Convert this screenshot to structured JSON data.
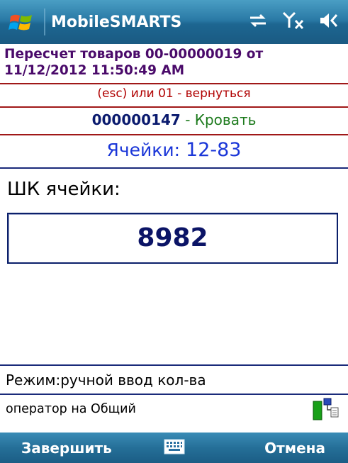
{
  "titlebar": {
    "app_name": "MobileSMARTS",
    "icons": [
      "windows-start-icon",
      "sync-icon",
      "no-signal-icon",
      "volume-icon"
    ]
  },
  "document": {
    "title": "Пересчет товаров 00-00000019 от 11/12/2012 11:50:49 AM"
  },
  "back_hint": "(esc) или 01 - вернуться",
  "item": {
    "code": "000000147",
    "separator": " - ",
    "name": "Кровать"
  },
  "cell": {
    "label": "Ячейки: ",
    "value": "12-83"
  },
  "barcode": {
    "label": "ШК ячейки:",
    "value": "8982"
  },
  "mode": "Режим:ручной ввод кол-ва",
  "operator": "оператор на Общий",
  "softkeys": {
    "left": "Завершить",
    "right": "Отмена",
    "center_icon": "keyboard-icon"
  },
  "colors": {
    "title_bar": "#2a7aa6",
    "doc_title": "#4a0a6a",
    "back_hint": "#b00000",
    "item_code": "#0a1a6e",
    "item_name": "#1c7a1c",
    "cell": "#1a36d8",
    "divider_red": "#a01818",
    "divider_blue": "#1a2a7a"
  }
}
